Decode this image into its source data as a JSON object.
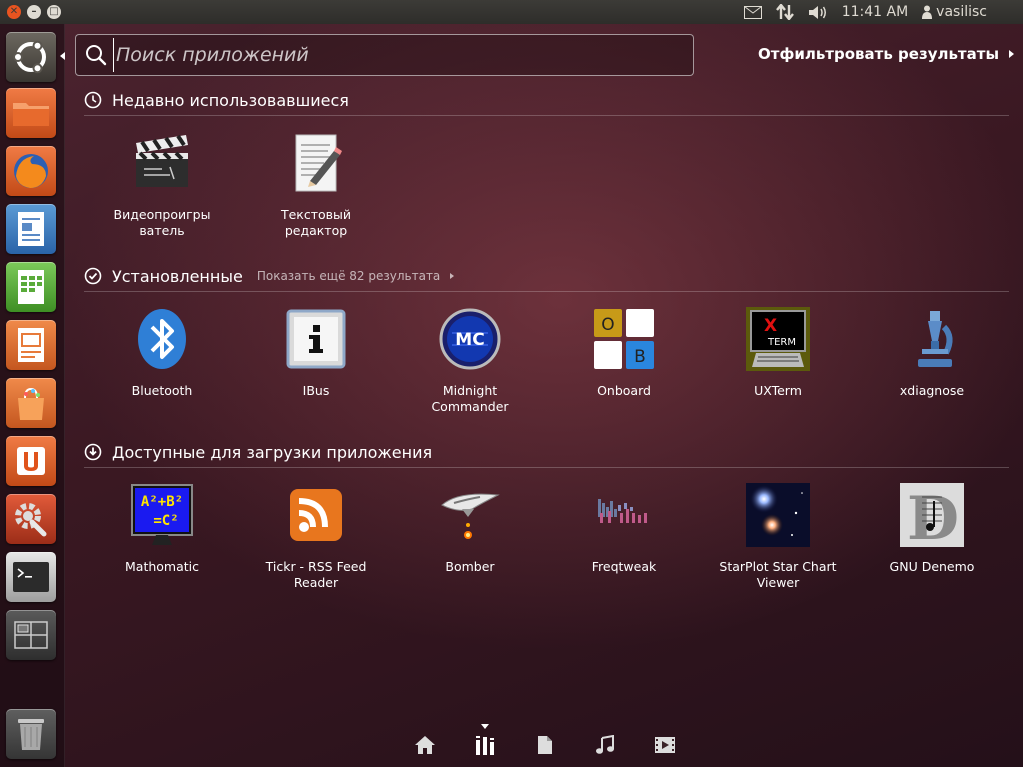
{
  "top_panel": {
    "clock": "11:41 AM",
    "user": "vasilisc"
  },
  "search": {
    "placeholder": "Поиск приложений",
    "value": ""
  },
  "filter_label": "Отфильтровать результаты",
  "sections": {
    "recent": {
      "title": "Недавно использовавшиеся",
      "apps": [
        "Видеопроигры ватель",
        "Текстовый редактор"
      ]
    },
    "installed": {
      "title": "Установленные",
      "more": "Показать ещё 82 результата",
      "apps": [
        "Bluetooth",
        "IBus",
        "Midnight Commander",
        "Onboard",
        "UXTerm",
        "xdiagnose"
      ]
    },
    "available": {
      "title": "Доступные для загрузки приложения",
      "apps": [
        "Mathomatic",
        "Tickr - RSS Feed Reader",
        "Bomber",
        "Freqtweak",
        "StarPlot Star Chart Viewer",
        "GNU Denemo"
      ]
    }
  },
  "icons": {
    "onboard_keys": [
      "O",
      "",
      "",
      "B"
    ],
    "uxterm_text": [
      "X",
      "TERM"
    ],
    "mc_text": "MC",
    "mathomatic_text": [
      "A²+B²",
      "=C²"
    ],
    "denemo_letter": "D"
  },
  "colors": {
    "accent": "#e95420",
    "panel": "#3c3b37"
  }
}
